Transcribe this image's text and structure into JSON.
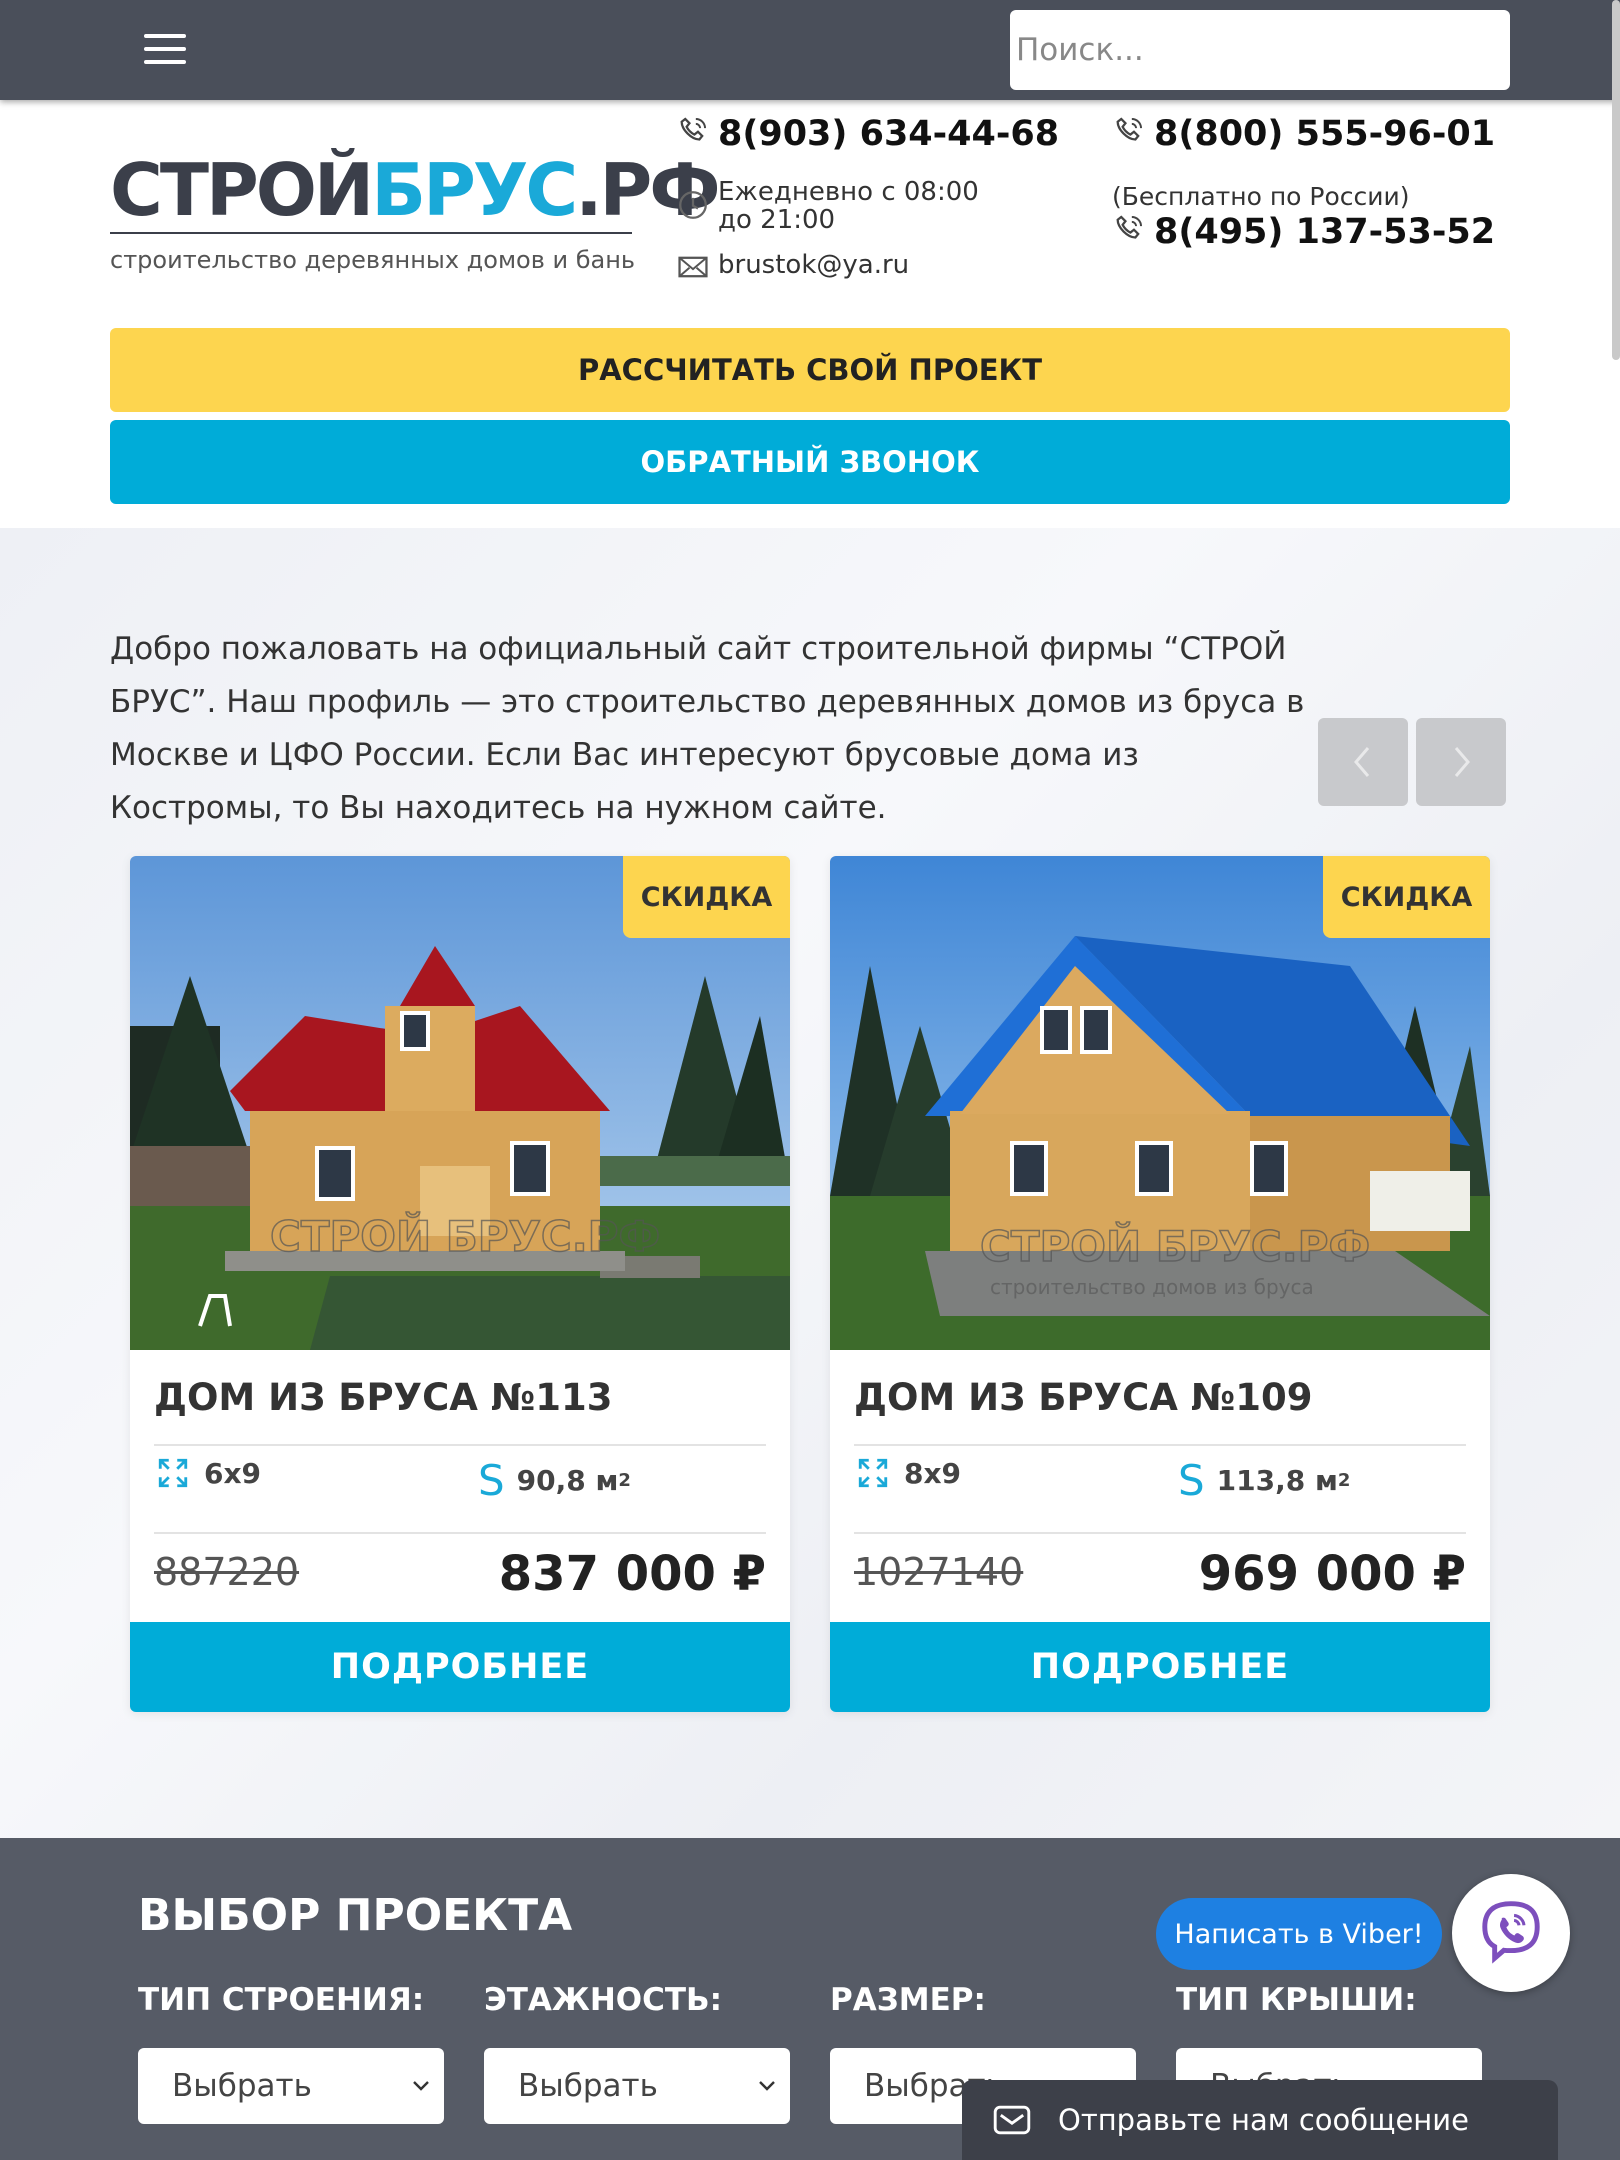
{
  "topbar": {
    "search_placeholder": "Поиск..."
  },
  "logo": {
    "part1": "СТРОЙ",
    "part2": "БРУС",
    "part3": ".РФ",
    "subtitle": "строительство деревянных домов и бань"
  },
  "contacts": {
    "phone1": "8(903) 634-44-68",
    "hours": "Ежедневно с 08:00 до 21:00",
    "email": "brustok@ya.ru",
    "phone2": "8(800) 555-96-01",
    "phone2_note": "(Бесплатно по России)",
    "phone3": "8(495) 137-53-52"
  },
  "buttons": {
    "calc": "РАССЧИТАТЬ СВОЙ ПРОЕКТ",
    "callback": "ОБРАТНЫЙ ЗВОНОК"
  },
  "intro": "Добро пожаловать на официальный сайт строительной фирмы “СТРОЙ БРУС”. Наш профиль — это строительство деревянных домов из бруса в Москве и ЦФО России. Если Вас интересуют брусовые дома из Костромы, то Вы находитесь на нужном сайте.",
  "cards": [
    {
      "badge": "СКИДКА",
      "title": "ДОМ ИЗ БРУСА №113",
      "size": "6х9",
      "area": "90,8 м",
      "area_sup": "2",
      "old_price": "887220",
      "price": "837 000 ₽",
      "button": "ПОДРОБНЕЕ",
      "watermark": "СТРОЙ БРУС.РФ",
      "roof_color": "#a8161f"
    },
    {
      "badge": "СКИДКА",
      "title": "ДОМ ИЗ БРУСА №109",
      "size": "8х9",
      "area": "113,8 м",
      "area_sup": "2",
      "old_price": "1027140",
      "price": "969 000 ₽",
      "button": "ПОДРОБНЕЕ",
      "watermark": "СТРОЙ БРУС.РФ",
      "watermark_sub": "строительство домов из бруса",
      "roof_color": "#1f6fd6"
    }
  ],
  "selector": {
    "title": "ВЫБОР ПРОЕКТА",
    "labels": [
      "ТИП СТРОЕНИЯ:",
      "ЭТАЖНОСТЬ:",
      "РАЗМЕР:",
      "ТИП КРЫШИ:"
    ],
    "value": "Выбрать"
  },
  "viber": {
    "tip": "Написать в Viber!"
  },
  "chat": {
    "label": "Отправьте нам сообщение"
  },
  "colors": {
    "accent_yellow": "#fdd54f",
    "accent_blue": "#00acd8",
    "dark": "#4a4f5a"
  }
}
